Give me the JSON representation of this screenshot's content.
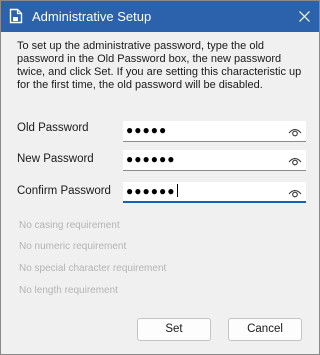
{
  "window": {
    "title": "Administrative Setup",
    "titlebar_color": "#2b62ab",
    "icon": "document-icon",
    "close_icon": "close-icon"
  },
  "instructions": "To set up the administrative password, type the old password in the Old Password box, the new password twice, and click Set. If you are setting this characteristic up for the first time, the old password will be disabled.",
  "fields": [
    {
      "label": "Old Password",
      "value": "●●●●●",
      "icon": "eye-icon"
    },
    {
      "label": "New Password",
      "value": "●●●●●●",
      "icon": "eye-icon"
    },
    {
      "label": "Confirm Password",
      "value": "●●●●●●",
      "icon": "eye-icon",
      "focused": true
    }
  ],
  "requirements": [
    "No casing requirement",
    "No numeric requirement",
    "No special character requirement",
    "No length requirement"
  ],
  "buttons": {
    "set": "Set",
    "cancel": "Cancel"
  }
}
